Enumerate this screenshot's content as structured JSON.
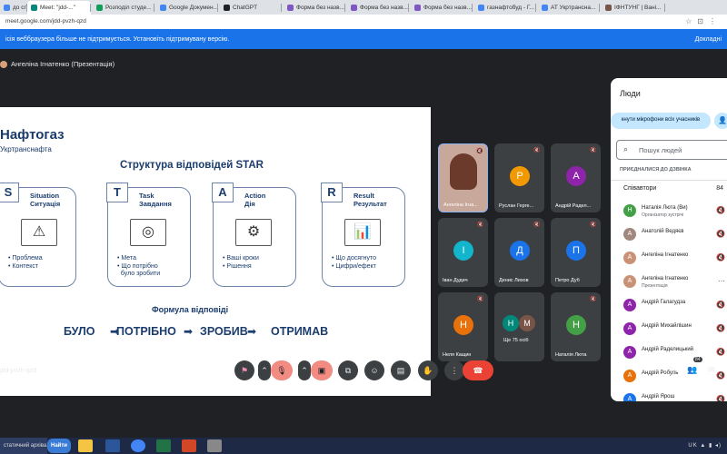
{
  "browser": {
    "tabs": [
      {
        "label": "до сп...",
        "color": "#4285f4"
      },
      {
        "label": "Meet: \"jdd-...\"",
        "color": "#00897b",
        "active": true
      },
      {
        "label": "Розподіл студе...",
        "color": "#0f9d58"
      },
      {
        "label": "Google Докумен...",
        "color": "#4285f4"
      },
      {
        "label": "ChatGPT",
        "color": "#202124"
      },
      {
        "label": "Форма без назв...",
        "color": "#7e57c2"
      },
      {
        "label": "Форма без назв...",
        "color": "#7e57c2"
      },
      {
        "label": "Форма без назв...",
        "color": "#7e57c2"
      },
      {
        "label": "газнафтобуд - Г...",
        "color": "#4285f4"
      },
      {
        "label": "АТ Укртрансна...",
        "color": "#4285f4"
      },
      {
        "label": "ІФНТУНГ | Вані...",
        "color": "#795548"
      }
    ],
    "url": "meet.google.com/jdd-pvzh-qzd",
    "infobar": {
      "message": "ісія веббраузера більше не підтримується. Установіть підтримувану версію.",
      "action": "Докладні"
    }
  },
  "meet": {
    "presenter_label": "Ангеліна Ігнатенко (Презентація)",
    "meeting_code": "jdd-pvzh-qzd"
  },
  "slide": {
    "logo_line1": "Нафтогаз",
    "logo_line2": "Укртранснафта",
    "title": "Структура відповідей STAR",
    "cards": [
      {
        "letter": "S",
        "en": "Situation",
        "ua": "Ситуація",
        "glyph": "⚠",
        "items": [
          "• Проблема",
          "• Контекст"
        ]
      },
      {
        "letter": "T",
        "en": "Task",
        "ua": "Завдання",
        "glyph": "◎",
        "items": [
          "• Мета",
          "• Що потрібно",
          "  було зробити"
        ]
      },
      {
        "letter": "A",
        "en": "Action",
        "ua": "Дія",
        "glyph": "⚙",
        "items": [
          "• Ваші кроки",
          "• Рішення"
        ]
      },
      {
        "letter": "R",
        "en": "Result",
        "ua": "Результат",
        "glyph": "📊",
        "items": [
          "• Що досягнуто",
          "• Цифри/ефект"
        ]
      }
    ],
    "formula_title": "Формула відповіді",
    "formula": [
      "БУЛО",
      "ПОТРІБНО",
      "ЗРОБИВ",
      "ОТРИМАВ"
    ]
  },
  "tiles": [
    {
      "name": "Ангеліна Ігна...",
      "letter": "",
      "color": "#a0614f"
    },
    {
      "name": "Руслан Герге...",
      "letter": "Р",
      "color": "#f29900"
    },
    {
      "name": "Андрій Радел...",
      "letter": "А",
      "color": "#8e24aa"
    },
    {
      "name": "Іван Дудич",
      "letter": "І",
      "color": "#12b5cb"
    },
    {
      "name": "Денис Лихов",
      "letter": "Д",
      "color": "#1a73e8"
    },
    {
      "name": "Петро Дуб",
      "letter": "П",
      "color": "#1a73e8"
    },
    {
      "name": "Неля Кащин",
      "letter": "Н",
      "color": "#e8710a"
    },
    {
      "name": "Ще 75 осіб",
      "letter": "Н М",
      "color": "#3c4043"
    },
    {
      "name": "Наталія Люта",
      "letter": "Н",
      "color": "#43a047"
    }
  ],
  "people": {
    "title": "Люди",
    "mute_all": "кнути мікрофони всіх учасників",
    "search_placeholder": "Пошук людей",
    "joined_label": "ПРИЄДНАЛИСЯ ДО ДЗВІНКА",
    "cohosts_label": "Співавтори",
    "cohosts_count": "84",
    "list": [
      {
        "name": "Наталія Люта (Ви)",
        "sub": "Організатор зустрічі",
        "letter": "Н",
        "color": "#43a047"
      },
      {
        "name": "Анатолій Ведяєв",
        "sub": "",
        "letter": "А",
        "color": "#a1887f"
      },
      {
        "name": "Ангеліна Ігнатенко",
        "sub": "",
        "letter": "А",
        "color": "#c99274"
      },
      {
        "name": "Ангеліна Ігнатенко",
        "sub": "Презентація",
        "letter": "А",
        "color": "#c99274"
      },
      {
        "name": "Андрій Галагудза",
        "sub": "",
        "letter": "А",
        "color": "#8e24aa"
      },
      {
        "name": "Андрій Михайлішин",
        "sub": "",
        "letter": "А",
        "color": "#8e24aa"
      },
      {
        "name": "Андрій Раделицький",
        "sub": "",
        "letter": "А",
        "color": "#8e24aa"
      },
      {
        "name": "Андрій Робуль",
        "sub": "",
        "letter": "А",
        "color": "#e8710a"
      },
      {
        "name": "Андрій Ярош",
        "sub": "",
        "letter": "А",
        "color": "#1a73e8"
      }
    ]
  },
  "controls": {
    "people_count": "84"
  },
  "taskbar": {
    "search_text": "статичний архіва...",
    "search_btn": "Найти",
    "lang": "UK"
  }
}
